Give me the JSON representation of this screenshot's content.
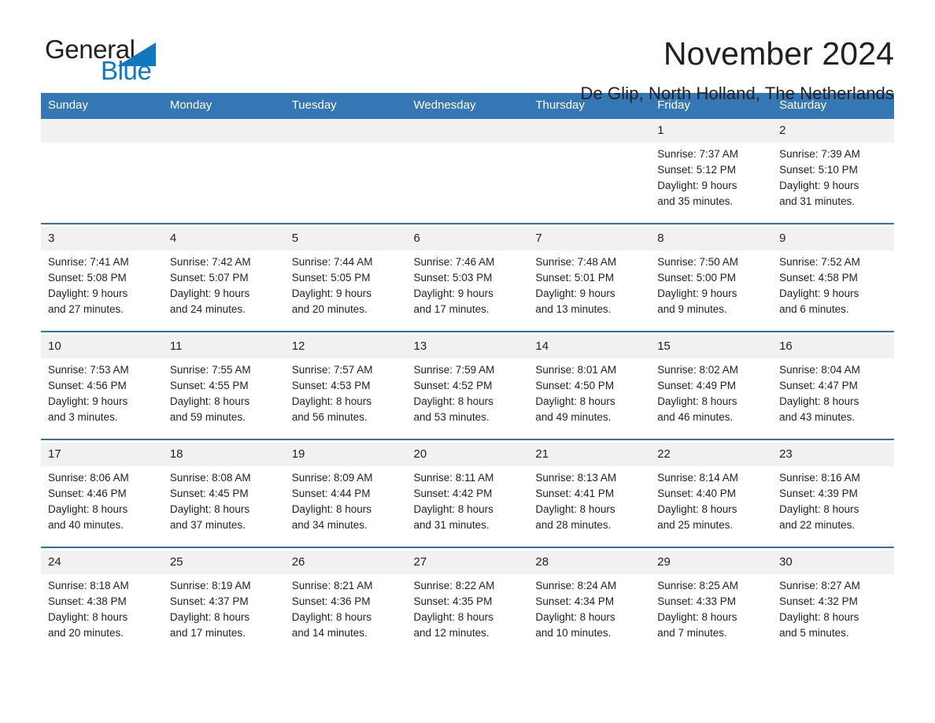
{
  "brand": {
    "word_one": "General",
    "word_two": "Blue",
    "triangle_icon": "triangle-icon",
    "accent_color": "#1278be"
  },
  "header": {
    "month_title": "November 2024",
    "location": "De Glip, North Holland, The Netherlands"
  },
  "calendar": {
    "header_bg": "#3576b4",
    "row_rule_color": "#2e72b0",
    "daynum_bg": "#f1f1f1",
    "weekday_headers": [
      "Sunday",
      "Monday",
      "Tuesday",
      "Wednesday",
      "Thursday",
      "Friday",
      "Saturday"
    ],
    "weeks": [
      [
        {
          "day": "",
          "lines": []
        },
        {
          "day": "",
          "lines": []
        },
        {
          "day": "",
          "lines": []
        },
        {
          "day": "",
          "lines": []
        },
        {
          "day": "",
          "lines": []
        },
        {
          "day": "1",
          "lines": [
            "Sunrise: 7:37 AM",
            "Sunset: 5:12 PM",
            "Daylight: 9 hours",
            "and 35 minutes."
          ]
        },
        {
          "day": "2",
          "lines": [
            "Sunrise: 7:39 AM",
            "Sunset: 5:10 PM",
            "Daylight: 9 hours",
            "and 31 minutes."
          ]
        }
      ],
      [
        {
          "day": "3",
          "lines": [
            "Sunrise: 7:41 AM",
            "Sunset: 5:08 PM",
            "Daylight: 9 hours",
            "and 27 minutes."
          ]
        },
        {
          "day": "4",
          "lines": [
            "Sunrise: 7:42 AM",
            "Sunset: 5:07 PM",
            "Daylight: 9 hours",
            "and 24 minutes."
          ]
        },
        {
          "day": "5",
          "lines": [
            "Sunrise: 7:44 AM",
            "Sunset: 5:05 PM",
            "Daylight: 9 hours",
            "and 20 minutes."
          ]
        },
        {
          "day": "6",
          "lines": [
            "Sunrise: 7:46 AM",
            "Sunset: 5:03 PM",
            "Daylight: 9 hours",
            "and 17 minutes."
          ]
        },
        {
          "day": "7",
          "lines": [
            "Sunrise: 7:48 AM",
            "Sunset: 5:01 PM",
            "Daylight: 9 hours",
            "and 13 minutes."
          ]
        },
        {
          "day": "8",
          "lines": [
            "Sunrise: 7:50 AM",
            "Sunset: 5:00 PM",
            "Daylight: 9 hours",
            "and 9 minutes."
          ]
        },
        {
          "day": "9",
          "lines": [
            "Sunrise: 7:52 AM",
            "Sunset: 4:58 PM",
            "Daylight: 9 hours",
            "and 6 minutes."
          ]
        }
      ],
      [
        {
          "day": "10",
          "lines": [
            "Sunrise: 7:53 AM",
            "Sunset: 4:56 PM",
            "Daylight: 9 hours",
            "and 3 minutes."
          ]
        },
        {
          "day": "11",
          "lines": [
            "Sunrise: 7:55 AM",
            "Sunset: 4:55 PM",
            "Daylight: 8 hours",
            "and 59 minutes."
          ]
        },
        {
          "day": "12",
          "lines": [
            "Sunrise: 7:57 AM",
            "Sunset: 4:53 PM",
            "Daylight: 8 hours",
            "and 56 minutes."
          ]
        },
        {
          "day": "13",
          "lines": [
            "Sunrise: 7:59 AM",
            "Sunset: 4:52 PM",
            "Daylight: 8 hours",
            "and 53 minutes."
          ]
        },
        {
          "day": "14",
          "lines": [
            "Sunrise: 8:01 AM",
            "Sunset: 4:50 PM",
            "Daylight: 8 hours",
            "and 49 minutes."
          ]
        },
        {
          "day": "15",
          "lines": [
            "Sunrise: 8:02 AM",
            "Sunset: 4:49 PM",
            "Daylight: 8 hours",
            "and 46 minutes."
          ]
        },
        {
          "day": "16",
          "lines": [
            "Sunrise: 8:04 AM",
            "Sunset: 4:47 PM",
            "Daylight: 8 hours",
            "and 43 minutes."
          ]
        }
      ],
      [
        {
          "day": "17",
          "lines": [
            "Sunrise: 8:06 AM",
            "Sunset: 4:46 PM",
            "Daylight: 8 hours",
            "and 40 minutes."
          ]
        },
        {
          "day": "18",
          "lines": [
            "Sunrise: 8:08 AM",
            "Sunset: 4:45 PM",
            "Daylight: 8 hours",
            "and 37 minutes."
          ]
        },
        {
          "day": "19",
          "lines": [
            "Sunrise: 8:09 AM",
            "Sunset: 4:44 PM",
            "Daylight: 8 hours",
            "and 34 minutes."
          ]
        },
        {
          "day": "20",
          "lines": [
            "Sunrise: 8:11 AM",
            "Sunset: 4:42 PM",
            "Daylight: 8 hours",
            "and 31 minutes."
          ]
        },
        {
          "day": "21",
          "lines": [
            "Sunrise: 8:13 AM",
            "Sunset: 4:41 PM",
            "Daylight: 8 hours",
            "and 28 minutes."
          ]
        },
        {
          "day": "22",
          "lines": [
            "Sunrise: 8:14 AM",
            "Sunset: 4:40 PM",
            "Daylight: 8 hours",
            "and 25 minutes."
          ]
        },
        {
          "day": "23",
          "lines": [
            "Sunrise: 8:16 AM",
            "Sunset: 4:39 PM",
            "Daylight: 8 hours",
            "and 22 minutes."
          ]
        }
      ],
      [
        {
          "day": "24",
          "lines": [
            "Sunrise: 8:18 AM",
            "Sunset: 4:38 PM",
            "Daylight: 8 hours",
            "and 20 minutes."
          ]
        },
        {
          "day": "25",
          "lines": [
            "Sunrise: 8:19 AM",
            "Sunset: 4:37 PM",
            "Daylight: 8 hours",
            "and 17 minutes."
          ]
        },
        {
          "day": "26",
          "lines": [
            "Sunrise: 8:21 AM",
            "Sunset: 4:36 PM",
            "Daylight: 8 hours",
            "and 14 minutes."
          ]
        },
        {
          "day": "27",
          "lines": [
            "Sunrise: 8:22 AM",
            "Sunset: 4:35 PM",
            "Daylight: 8 hours",
            "and 12 minutes."
          ]
        },
        {
          "day": "28",
          "lines": [
            "Sunrise: 8:24 AM",
            "Sunset: 4:34 PM",
            "Daylight: 8 hours",
            "and 10 minutes."
          ]
        },
        {
          "day": "29",
          "lines": [
            "Sunrise: 8:25 AM",
            "Sunset: 4:33 PM",
            "Daylight: 8 hours",
            "and 7 minutes."
          ]
        },
        {
          "day": "30",
          "lines": [
            "Sunrise: 8:27 AM",
            "Sunset: 4:32 PM",
            "Daylight: 8 hours",
            "and 5 minutes."
          ]
        }
      ]
    ]
  }
}
